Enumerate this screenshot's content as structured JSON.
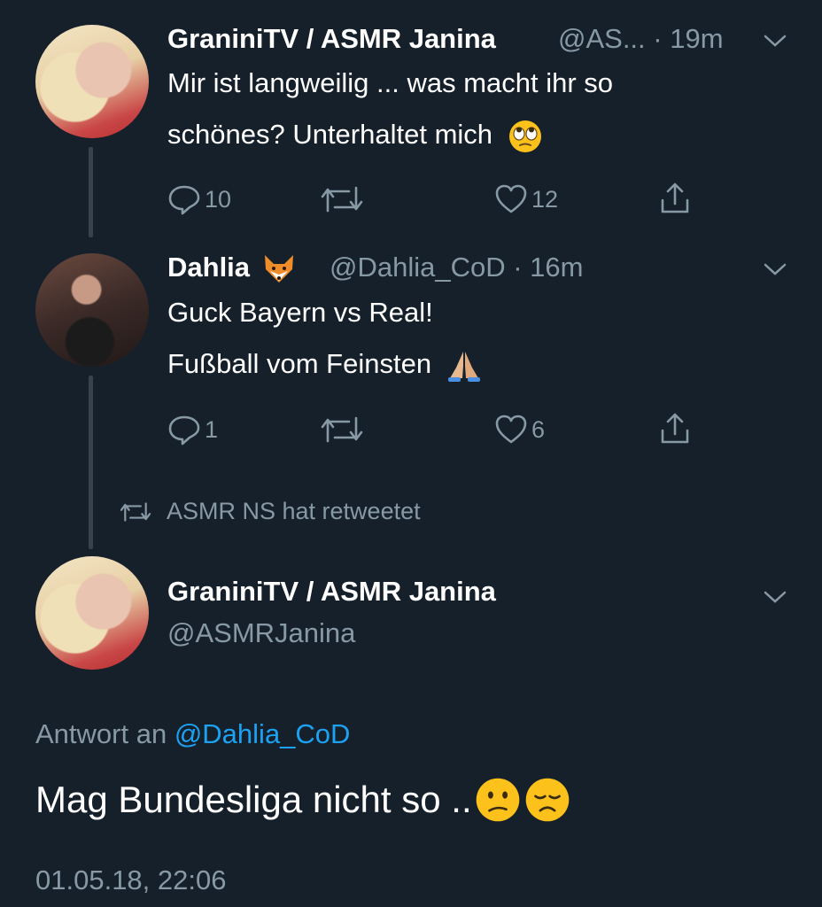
{
  "tweet1": {
    "name": "GraniniTV / ASMR Janina",
    "handle_time": "@AS... · 19m",
    "line1": "Mir ist langweilig ... was macht ihr so",
    "line2": "schönes? Unterhaltet mich",
    "emoji": "eye-roll-emoji",
    "replies": "10",
    "likes": "12"
  },
  "tweet2": {
    "name": "Dahlia",
    "name_emoji": "fox-emoji",
    "handle_time": "@Dahlia_CoD · 16m",
    "line1": "Guck Bayern vs Real!",
    "line2": "Fußball vom Feinsten",
    "emoji": "folded-hands-emoji",
    "replies": "1",
    "likes": "6"
  },
  "retweet_label": "ASMR NS hat retweetet",
  "main_tweet": {
    "name": "GraniniTV / ASMR Janina",
    "handle": "@ASMRJanina",
    "reply_prefix": "Antwort an",
    "reply_to": "@Dahlia_CoD",
    "text": "Mag Bundesliga nicht so ..",
    "emojis": [
      "confused-face-emoji",
      "disappointed-face-emoji"
    ],
    "timestamp": "01.05.18, 22:06"
  },
  "colors": {
    "background": "#15202b",
    "secondary_text": "#8899a6",
    "link": "#1da1f2",
    "thread_line": "#38444d"
  }
}
